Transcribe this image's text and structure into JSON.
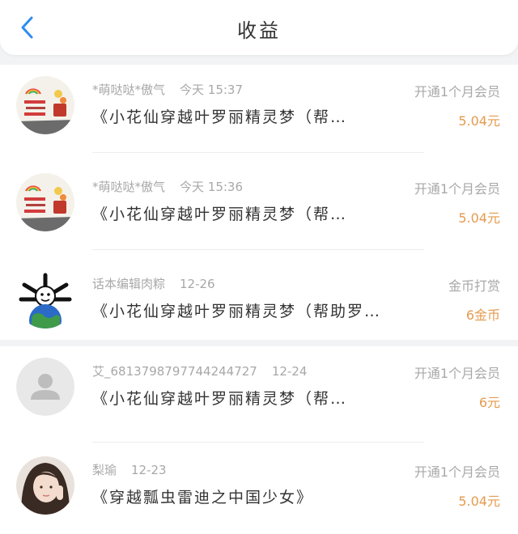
{
  "header": {
    "title": "收益"
  },
  "colors": {
    "amount": "#e59b4e",
    "back_arrow": "#2f8cf0"
  },
  "records": [
    {
      "user": "*萌哒哒*傲气",
      "time": "今天 15:37",
      "work": "《小花仙穿越叶罗丽精灵梦（帮…",
      "type": "开通1个月会员",
      "amount": "5.04元",
      "avatar_icon": "sticker-avatar-icon"
    },
    {
      "user": "*萌哒哒*傲气",
      "time": "今天 15:36",
      "work": "《小花仙穿越叶罗丽精灵梦（帮…",
      "type": "开通1个月会员",
      "amount": "5.04元",
      "avatar_icon": "sticker-avatar-icon"
    },
    {
      "user": "话本编辑肉粽",
      "time": "12-26",
      "work": "《小花仙穿越叶罗丽精灵梦（帮助罗…",
      "type": "金币打赏",
      "amount": "6金币",
      "avatar_icon": "globe-avatar-icon"
    },
    {
      "user": "艾_6813798797744244727",
      "time": "12-24",
      "work": "《小花仙穿越叶罗丽精灵梦（帮…",
      "type": "开通1个月会员",
      "amount": "6元",
      "avatar_icon": "default-user-icon"
    },
    {
      "user": "梨瑜",
      "time": "12-23",
      "work": "《穿越瓢虫雷迪之中国少女》",
      "type": "开通1个月会员",
      "amount": "5.04元",
      "avatar_icon": "photo-avatar-icon"
    }
  ]
}
